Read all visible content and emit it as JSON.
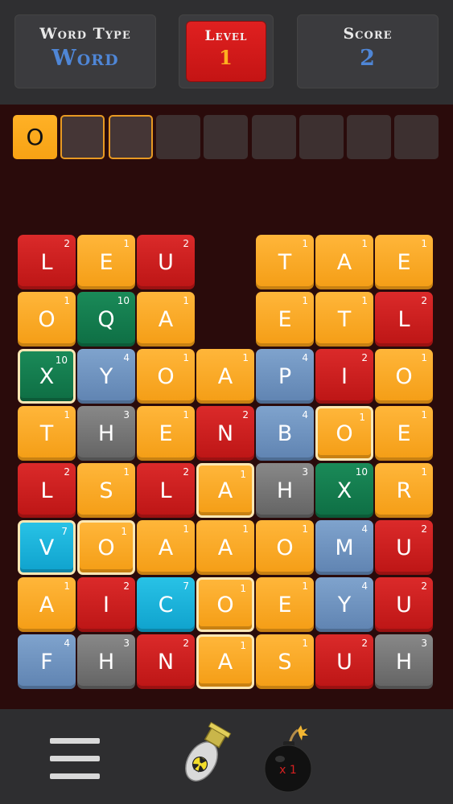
{
  "header": {
    "word_type_label": "Word Type",
    "word_type_value": "Word",
    "level_label": "Level",
    "level_value": "1",
    "score_label": "Score",
    "score_value": "2"
  },
  "word_slots": [
    "O",
    "",
    "",
    "",
    "",
    "",
    "",
    "",
    ""
  ],
  "pending_slots": [
    1,
    2
  ],
  "colors": {
    "orange": "#f7a214",
    "red": "#c41414",
    "green": "#0e6e44",
    "blue": "#5f83b1",
    "gray": "#636363",
    "cyan": "#0fa2cd",
    "score_text": "#4f86d6",
    "level_text": "#ffb020"
  },
  "board": [
    [
      {
        "l": "L",
        "p": "2",
        "c": "red"
      },
      {
        "l": "E",
        "p": "1",
        "c": "orange"
      },
      {
        "l": "U",
        "p": "2",
        "c": "red"
      },
      null,
      {
        "l": "T",
        "p": "1",
        "c": "orange"
      },
      {
        "l": "A",
        "p": "1",
        "c": "orange"
      },
      {
        "l": "E",
        "p": "1",
        "c": "orange"
      }
    ],
    [
      {
        "l": "O",
        "p": "1",
        "c": "orange"
      },
      {
        "l": "Q",
        "p": "10",
        "c": "green"
      },
      {
        "l": "A",
        "p": "1",
        "c": "orange"
      },
      null,
      {
        "l": "E",
        "p": "1",
        "c": "orange"
      },
      {
        "l": "T",
        "p": "1",
        "c": "orange"
      },
      {
        "l": "L",
        "p": "2",
        "c": "red"
      }
    ],
    [
      {
        "l": "X",
        "p": "10",
        "c": "green",
        "s": true
      },
      {
        "l": "Y",
        "p": "4",
        "c": "blue"
      },
      {
        "l": "O",
        "p": "1",
        "c": "orange"
      },
      {
        "l": "A",
        "p": "1",
        "c": "orange"
      },
      {
        "l": "P",
        "p": "4",
        "c": "blue"
      },
      {
        "l": "I",
        "p": "2",
        "c": "red"
      },
      {
        "l": "O",
        "p": "1",
        "c": "orange"
      }
    ],
    [
      {
        "l": "T",
        "p": "1",
        "c": "orange"
      },
      {
        "l": "H",
        "p": "3",
        "c": "gray"
      },
      {
        "l": "E",
        "p": "1",
        "c": "orange"
      },
      {
        "l": "N",
        "p": "2",
        "c": "red"
      },
      {
        "l": "B",
        "p": "4",
        "c": "blue"
      },
      {
        "l": "O",
        "p": "1",
        "c": "orange",
        "s": true
      },
      {
        "l": "E",
        "p": "1",
        "c": "orange"
      }
    ],
    [
      {
        "l": "L",
        "p": "2",
        "c": "red"
      },
      {
        "l": "S",
        "p": "1",
        "c": "orange"
      },
      {
        "l": "L",
        "p": "2",
        "c": "red"
      },
      {
        "l": "A",
        "p": "1",
        "c": "orange",
        "s": true
      },
      {
        "l": "H",
        "p": "3",
        "c": "gray"
      },
      {
        "l": "X",
        "p": "10",
        "c": "green"
      },
      {
        "l": "R",
        "p": "1",
        "c": "orange"
      }
    ],
    [
      {
        "l": "V",
        "p": "7",
        "c": "cyan",
        "s": true
      },
      {
        "l": "O",
        "p": "1",
        "c": "orange",
        "s": true
      },
      {
        "l": "A",
        "p": "1",
        "c": "orange"
      },
      {
        "l": "A",
        "p": "1",
        "c": "orange"
      },
      {
        "l": "O",
        "p": "1",
        "c": "orange"
      },
      {
        "l": "M",
        "p": "4",
        "c": "blue"
      },
      {
        "l": "U",
        "p": "2",
        "c": "red"
      }
    ],
    [
      {
        "l": "A",
        "p": "1",
        "c": "orange"
      },
      {
        "l": "I",
        "p": "2",
        "c": "red"
      },
      {
        "l": "C",
        "p": "7",
        "c": "cyan"
      },
      {
        "l": "O",
        "p": "1",
        "c": "orange",
        "s": true
      },
      {
        "l": "E",
        "p": "1",
        "c": "orange"
      },
      {
        "l": "Y",
        "p": "4",
        "c": "blue"
      },
      {
        "l": "U",
        "p": "2",
        "c": "red"
      }
    ],
    [
      {
        "l": "F",
        "p": "4",
        "c": "blue"
      },
      {
        "l": "H",
        "p": "3",
        "c": "gray"
      },
      {
        "l": "N",
        "p": "2",
        "c": "red"
      },
      {
        "l": "A",
        "p": "1",
        "c": "orange",
        "s": true
      },
      {
        "l": "S",
        "p": "1",
        "c": "orange"
      },
      {
        "l": "U",
        "p": "2",
        "c": "red"
      },
      {
        "l": "H",
        "p": "3",
        "c": "gray"
      }
    ]
  ],
  "powerups": {
    "bomb_count": "x 1"
  },
  "icons": [
    "menu-icon",
    "nuke-icon",
    "bomb-icon"
  ]
}
